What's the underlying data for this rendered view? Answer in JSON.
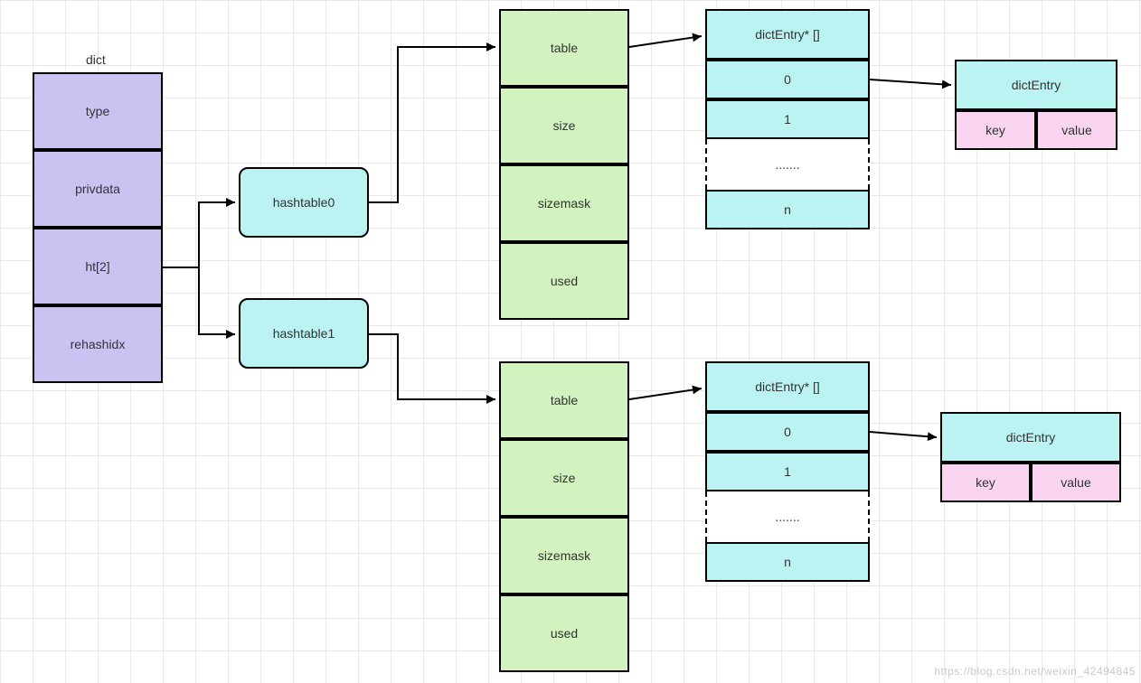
{
  "dict": {
    "title": "dict",
    "fields": [
      "type",
      "privdata",
      "ht[2]",
      "rehashidx"
    ]
  },
  "hashtables": [
    "hashtable0",
    "hashtable1"
  ],
  "htfields": [
    "table",
    "size",
    "sizemask",
    "used"
  ],
  "entryArray": {
    "header": "dictEntry* []",
    "indices": [
      "0",
      "1"
    ],
    "ellipsis": ".......",
    "last": "n"
  },
  "entry": {
    "title": "dictEntry",
    "key": "key",
    "value": "value"
  },
  "watermark": "https://blog.csdn.net/weixin_42494845"
}
